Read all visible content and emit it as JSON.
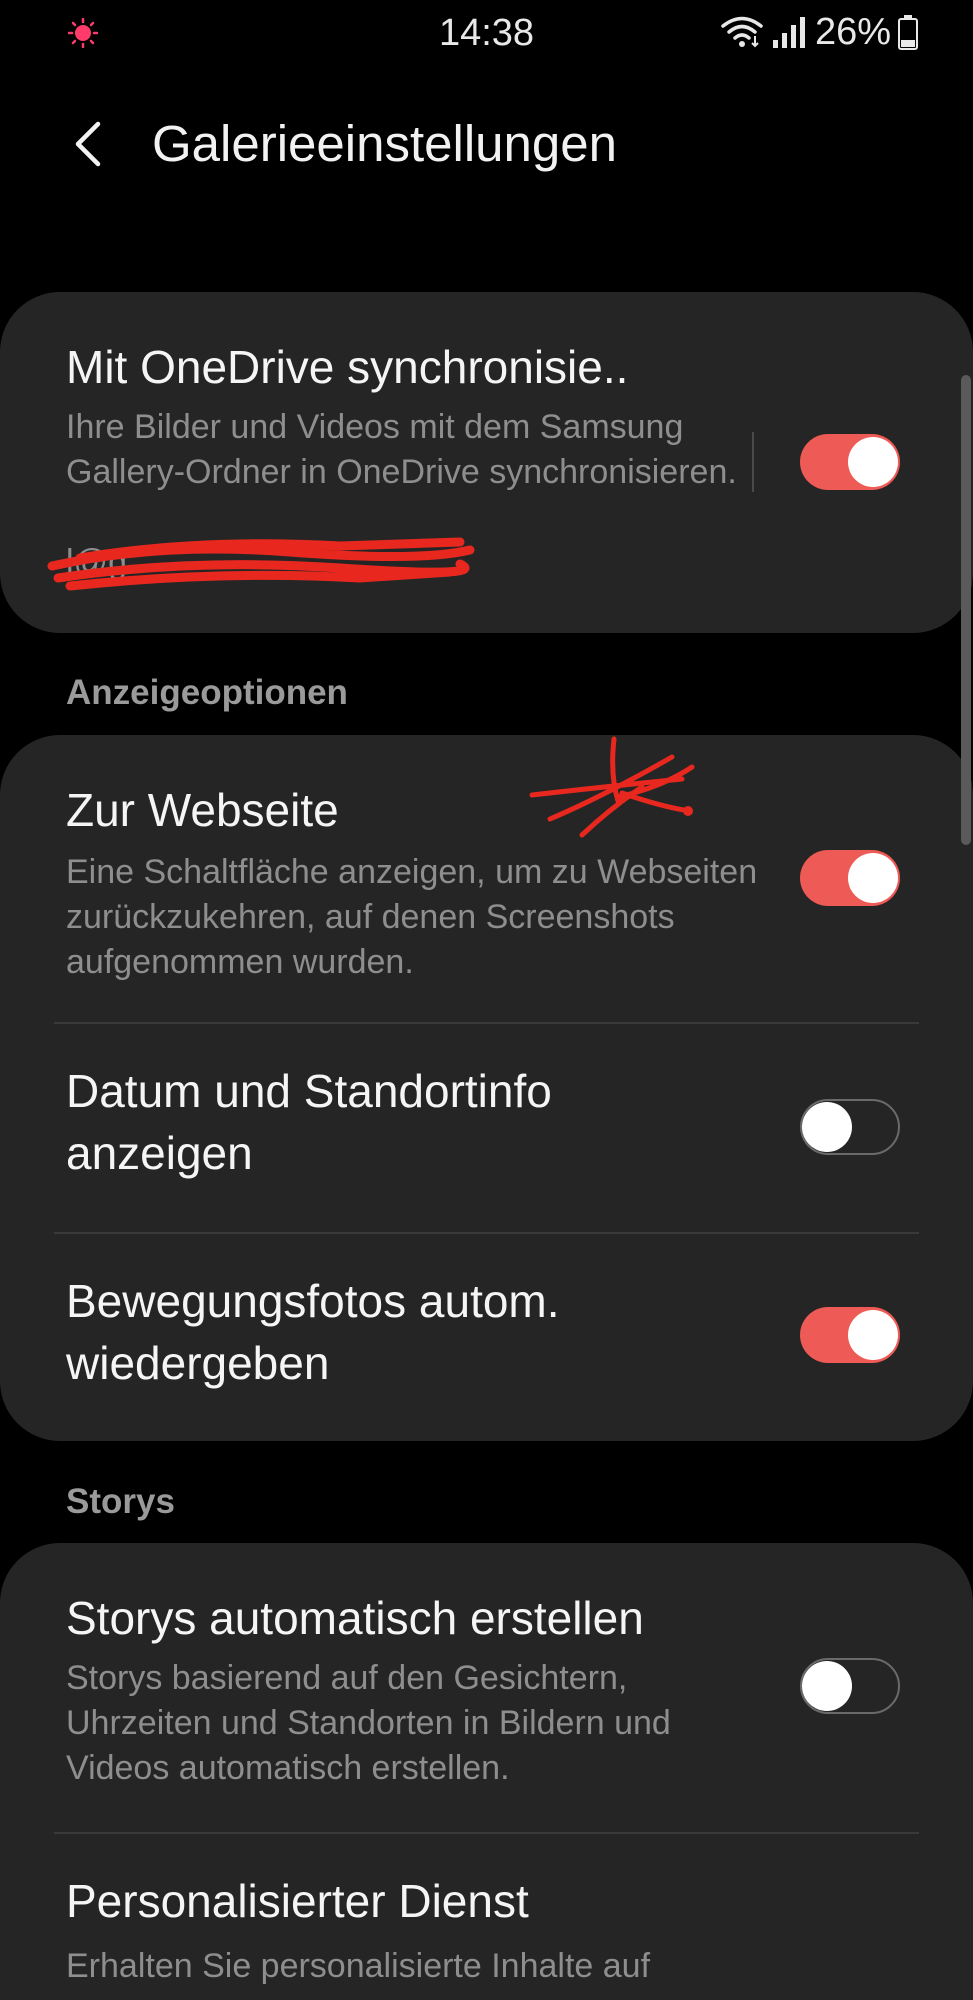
{
  "status_bar": {
    "time": "14:38",
    "battery": "26%",
    "indicator_color": "#ff3b6b",
    "icons": [
      "wifi-icon",
      "signal-icon",
      "battery-icon"
    ]
  },
  "header": {
    "title": "Galerieeinstellungen",
    "back_icon": "back-arrow-icon"
  },
  "sync": {
    "title": "Mit OneDrive synchronisie..",
    "description": "Ihre Bilder und Videos mit dem Samsung Gallery-Ordner in OneDrive synchronisieren.",
    "account_redacted": "l@g",
    "enabled": true
  },
  "sections": {
    "display": "Anzeigeoptionen",
    "stories": "Storys"
  },
  "display_options": [
    {
      "title": "Zur Webseite",
      "description": "Eine Schaltfläche anzeigen, um zu Webseiten zurückzukehren, auf denen Screenshots aufgenommen wurden.",
      "enabled": true
    },
    {
      "title_line1": "Datum und Standortinfo",
      "title_line2": "anzeigen",
      "enabled": false
    },
    {
      "title_line1": "Bewegungsfotos autom.",
      "title_line2": "wiedergeben",
      "enabled": true
    }
  ],
  "stories": [
    {
      "title": "Storys automatisch erstellen",
      "description": "Storys basierend auf den Gesichtern, Uhrzeiten und Standorten in Bildern und Videos automatisch erstellen.",
      "enabled": false
    },
    {
      "title": "Personalisierter Dienst",
      "description": "Erhalten Sie personalisierte Inhalte auf"
    }
  ],
  "colors": {
    "background": "#000000",
    "card": "#252525",
    "toggle_on": "#ee5a55",
    "annotation": "#e8281e"
  }
}
